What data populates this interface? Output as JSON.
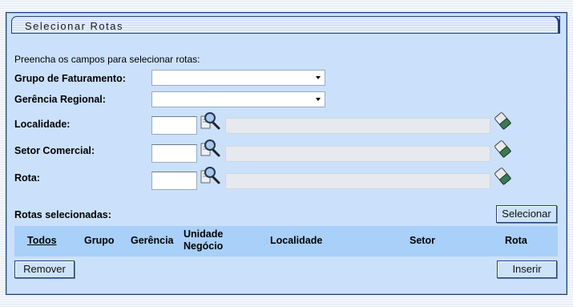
{
  "panel": {
    "title": "Selecionar Rotas"
  },
  "form": {
    "instruction": "Preencha os campos para selecionar rotas:",
    "grupo_label": "Grupo de Faturamento:",
    "grupo_value": "",
    "gerencia_label": "Gerência Regional:",
    "gerencia_value": "",
    "localidade_label": "Localidade:",
    "localidade_value": "",
    "setor_label": "Setor Comercial:",
    "setor_value": "",
    "rota_label": "Rota:",
    "rota_value": ""
  },
  "icons": {
    "search": "magnifier-icon",
    "clear": "eraser-icon"
  },
  "selected": {
    "label": "Rotas selecionadas:",
    "select_button": "Selecionar",
    "columns": [
      "Todos",
      "Grupo",
      "Gerência",
      "Unidade Negócio",
      "Localidade",
      "Setor",
      "Rota"
    ],
    "rows": []
  },
  "actions": {
    "remove_button": "Remover",
    "insert_button": "Inserir"
  }
}
